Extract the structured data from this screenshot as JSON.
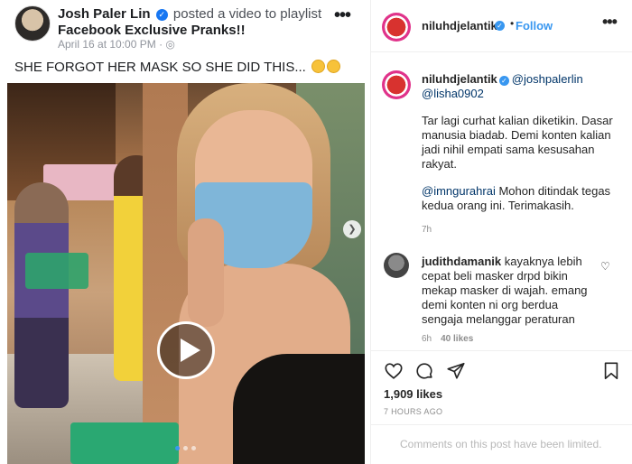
{
  "facebook_post": {
    "author": "Josh Paler Lin",
    "action_text": "posted a video to playlist",
    "playlist": "Facebook Exclusive Pranks!!",
    "timestamp": "April 16 at 10:00 PM",
    "more_label": "•••",
    "caption": "SHE FORGOT HER MASK SO SHE DID THIS...",
    "caption_icons": [
      "laughing-emoji",
      "laughing-emoji"
    ],
    "video": {
      "carousel_total": 3,
      "carousel_active_index": 0
    }
  },
  "instagram": {
    "header": {
      "username": "niluhdjelantik",
      "separator": "•",
      "follow_label": "Follow",
      "more_label": "•••"
    },
    "caption": {
      "username": "niluhdjelantik",
      "mentions": "@joshpalerlin @lisha0902",
      "paragraph1": "Tar lagi curhat kalian diketikin. Dasar manusia biadab. Demi konten kalian jadi nihil empati sama kesusahan rakyat.",
      "mention2": "@imngurahrai",
      "paragraph2": "Mohon ditindak tegas kedua orang ini. Terimakasih.",
      "time": "7h"
    },
    "comment": {
      "username": "judithdamanik",
      "text": "kayaknya lebih cepat beli masker drpd bikin mekap masker di wajah. emang demi konten ni org berdua sengaja melanggar peraturan",
      "time": "6h",
      "likes": "40 likes"
    },
    "likes_count": "1,909 likes",
    "age": "7 HOURS AGO",
    "comments_limited": "Comments on this post have been limited.",
    "colors": {
      "link": "#003569",
      "accent": "#3897f0",
      "muted": "#8e8e8e"
    }
  }
}
